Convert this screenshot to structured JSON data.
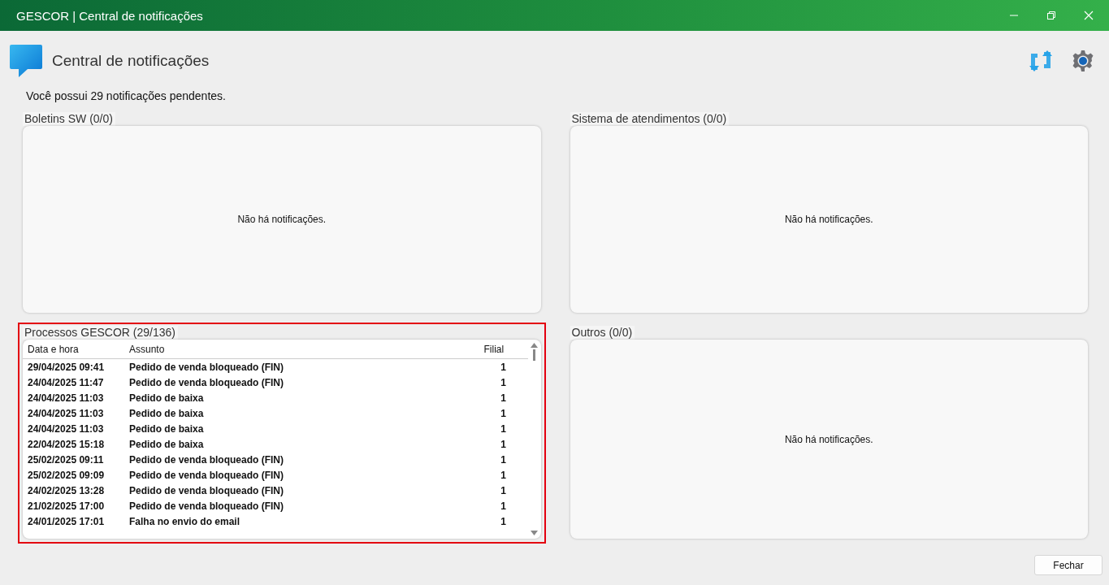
{
  "window": {
    "title": "GESCOR | Central de notificações",
    "controls": [
      {
        "kind": "minimize"
      },
      {
        "kind": "restore"
      },
      {
        "kind": "close"
      }
    ]
  },
  "header": {
    "title": "Central de notificações",
    "message": "Você possui 29 notificações pendentes."
  },
  "panels": [
    {
      "kind": "empty",
      "title": "Boletins SW (0/0)",
      "highlighted": false,
      "empty_text": "Não há notificações."
    },
    {
      "kind": "empty",
      "title": "Sistema de atendimentos (0/0)",
      "highlighted": false,
      "empty_text": "Não há notificações."
    },
    {
      "kind": "table",
      "title": "Processos GESCOR (29/136)",
      "highlighted": true,
      "columns": [
        "Data e hora",
        "Assunto",
        "Filial"
      ],
      "rows": [
        {
          "cells": [
            "29/04/2025 09:41",
            "Pedido de venda bloqueado (FIN)",
            "1"
          ],
          "unread": true
        },
        {
          "cells": [
            "24/04/2025 11:47",
            "Pedido de venda bloqueado (FIN)",
            "1"
          ],
          "unread": true
        },
        {
          "cells": [
            "24/04/2025 11:03",
            "Pedido de baixa",
            "1"
          ],
          "unread": true
        },
        {
          "cells": [
            "24/04/2025 11:03",
            "Pedido de baixa",
            "1"
          ],
          "unread": true
        },
        {
          "cells": [
            "24/04/2025 11:03",
            "Pedido de baixa",
            "1"
          ],
          "unread": true
        },
        {
          "cells": [
            "22/04/2025 15:18",
            "Pedido de baixa",
            "1"
          ],
          "unread": true
        },
        {
          "cells": [
            "25/02/2025 09:11",
            "Pedido de venda bloqueado (FIN)",
            "1"
          ],
          "unread": true
        },
        {
          "cells": [
            "25/02/2025 09:09",
            "Pedido de venda bloqueado (FIN)",
            "1"
          ],
          "unread": true
        },
        {
          "cells": [
            "24/02/2025 13:28",
            "Pedido de venda bloqueado (FIN)",
            "1"
          ],
          "unread": true
        },
        {
          "cells": [
            "21/02/2025 17:00",
            "Pedido de venda bloqueado (FIN)",
            "1"
          ],
          "unread": true
        },
        {
          "cells": [
            "24/01/2025 17:01",
            "Falha no envio do email",
            "1"
          ],
          "unread": true
        }
      ]
    },
    {
      "kind": "empty",
      "title": "Outros (0/0)",
      "highlighted": false,
      "empty_text": "Não há notificações."
    }
  ],
  "footer": {
    "button": "Fechar"
  }
}
